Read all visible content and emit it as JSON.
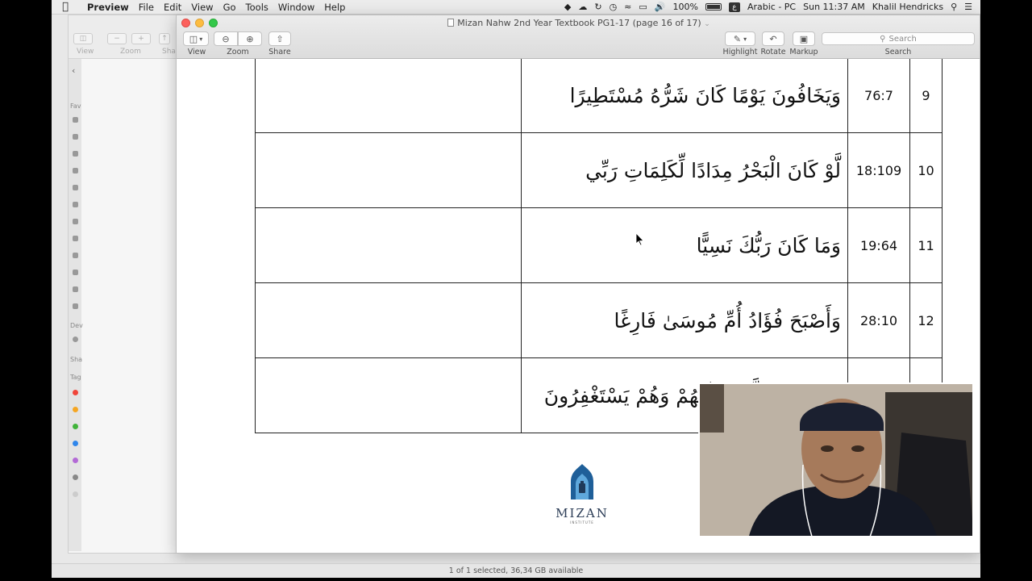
{
  "menubar": {
    "items": [
      "Preview",
      "File",
      "Edit",
      "View",
      "Go",
      "Tools",
      "Window",
      "Help"
    ],
    "battery": "100%",
    "input_source": "Arabic - PC",
    "clock": "Sun 11:37 AM",
    "user": "Khalil Hendricks"
  },
  "window": {
    "title": "Mizan Nahw 2nd Year Textbook PG1-17 (page 16 of 17)",
    "toolbar_left": [
      "View",
      "Zoom",
      "Share"
    ],
    "toolbar_right": [
      "Highlight",
      "Rotate",
      "Markup"
    ],
    "search_placeholder": "Search",
    "search_label": "Search"
  },
  "background_window": {
    "toolbar_labels": [
      "View",
      "Zoom",
      "Sha"
    ],
    "sidebar_labels": [
      "Fav",
      "Dev",
      "Sha",
      "Tag"
    ]
  },
  "table": {
    "rows": [
      {
        "num": "9",
        "ref": "76:7",
        "arabic": "وَيَخَافُونَ يَوْمًا كَانَ شَرُّهُ مُسْتَطِيرًا",
        "translation": ""
      },
      {
        "num": "10",
        "ref": "18:109",
        "arabic": "لَّوْ كَانَ الْبَحْرُ مِدَادًا لِّكَلِمَاتِ رَبِّي",
        "translation": ""
      },
      {
        "num": "11",
        "ref": "19:64",
        "arabic": "وَمَا كَانَ رَبُّكَ نَسِيًّا",
        "translation": ""
      },
      {
        "num": "12",
        "ref": "28:10",
        "arabic": "وَأَصْبَحَ فُؤَادُ أُمِّ مُوسَىٰ فَارِغًا",
        "translation": ""
      },
      {
        "num": "",
        "ref": "",
        "arabic": "وَمَا كَانَ اللَّهُ مُعَذِّبَهُمْ وَهُمْ يَسْتَغْفِرُونَ",
        "translation": ""
      }
    ]
  },
  "logo": {
    "name": "MIZAN",
    "sub": "INSTITUTE"
  },
  "statusbar": {
    "text": "1 of 1 selected, 36,34 GB available"
  },
  "colors": {
    "accent_logo": "#1f5f99",
    "close": "#fc605c",
    "minimize": "#fdbc40",
    "zoom": "#34c84a"
  }
}
